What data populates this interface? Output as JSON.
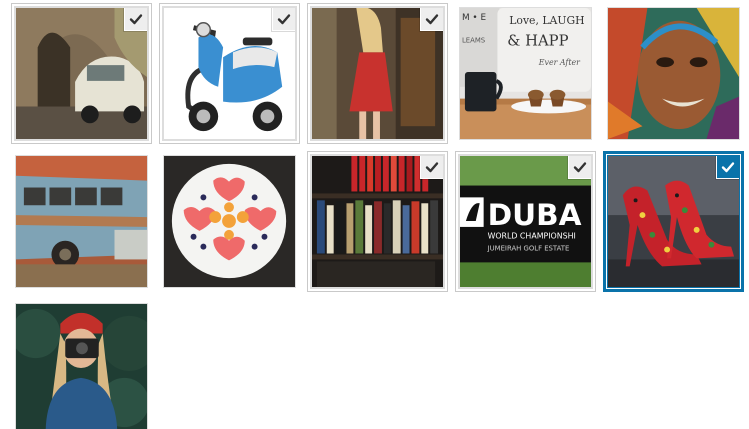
{
  "media_grid": {
    "items": [
      {
        "subject": "street-with-vintage-car",
        "checked": true,
        "focused": false
      },
      {
        "subject": "blue-scooter",
        "checked": true,
        "focused": false
      },
      {
        "subject": "woman-red-dress",
        "checked": true,
        "focused": false
      },
      {
        "subject": "mug-and-cupcakes-pillows",
        "checked": false,
        "focused": false,
        "text_line1": "Love, LAUGH",
        "text_line2": "& HAPP",
        "text_line3": "Ever After",
        "text_left": "M • E",
        "text_left2": "LEAMS"
      },
      {
        "subject": "graffiti-face",
        "checked": false,
        "focused": false
      },
      {
        "subject": "rusty-vw-bus",
        "checked": false,
        "focused": false
      },
      {
        "subject": "fruit-plate",
        "checked": false,
        "focused": false
      },
      {
        "subject": "bookshelf",
        "checked": true,
        "focused": false
      },
      {
        "subject": "dubai-golf-sign",
        "checked": true,
        "focused": false,
        "text_big": "DUBA",
        "text_small1": "WORLD CHAMPIONSHI",
        "text_small2": "JUMEIRAH GOLF ESTATE"
      },
      {
        "subject": "floral-high-heels",
        "checked": true,
        "focused": true
      },
      {
        "subject": "woman-with-camera",
        "checked": false,
        "focused": false
      }
    ]
  },
  "colors": {
    "selection_accent": "#0a73aa",
    "check_bg": "#eeeeee",
    "check_icon": "#333333",
    "check_icon_on_accent": "#ffffff"
  }
}
